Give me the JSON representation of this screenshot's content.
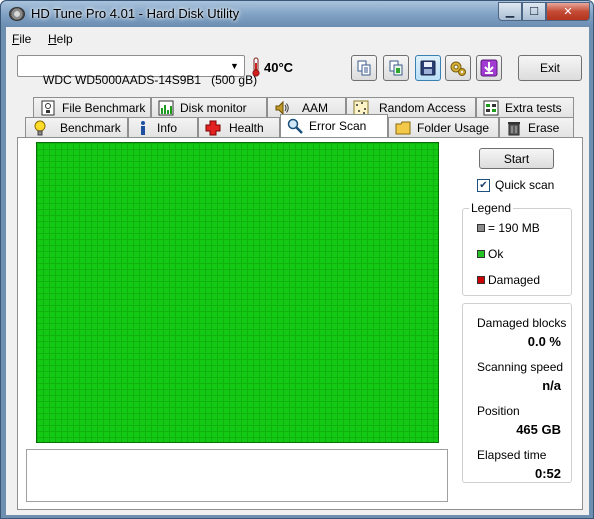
{
  "window": {
    "title": "HD Tune Pro 4.01 - Hard Disk Utility"
  },
  "menu": {
    "file": {
      "accel": "F",
      "rest": "ile"
    },
    "help": {
      "accel": "H",
      "rest": "elp"
    }
  },
  "toolbar": {
    "drive": "WDC WD5000AADS-14S9B1   (500 gB)",
    "temperature": "40°C",
    "buttons": [
      "copy-icon",
      "copy-screenshot-icon",
      "save-icon",
      "options-icon",
      "download-icon"
    ],
    "exit_label": "Exit"
  },
  "tabs": {
    "row1": [
      {
        "label": "File Benchmark",
        "icon": "file-benchmark-icon"
      },
      {
        "label": "Disk monitor",
        "icon": "disk-monitor-icon"
      },
      {
        "label": "AAM",
        "icon": "speaker-icon"
      },
      {
        "label": "Random Access",
        "icon": "random-access-icon"
      },
      {
        "label": "Extra tests",
        "icon": "extra-tests-icon"
      }
    ],
    "row2": [
      {
        "label": "Benchmark",
        "icon": "bulb-icon"
      },
      {
        "label": "Info",
        "icon": "info-icon"
      },
      {
        "label": "Health",
        "icon": "health-cross-icon"
      },
      {
        "label": "Error Scan",
        "icon": "magnifier-icon"
      },
      {
        "label": "Folder Usage",
        "icon": "folder-icon"
      },
      {
        "label": "Erase",
        "icon": "trash-icon"
      }
    ],
    "selected": "Error Scan"
  },
  "error_scan": {
    "start_label": "Start",
    "quick_scan_label": "Quick scan",
    "quick_scan_checked": true,
    "legend": {
      "title": "Legend",
      "block_size": "= 190 MB",
      "ok": "Ok",
      "damaged": "Damaged",
      "colors": {
        "block": "#8c8c8c",
        "ok": "#22c322",
        "damaged": "#cc0000"
      }
    },
    "stats": {
      "damaged_blocks_label": "Damaged blocks",
      "damaged_blocks_value": "0.0 %",
      "scanning_speed_label": "Scanning speed",
      "scanning_speed_value": "n/a",
      "position_label": "Position",
      "position_value": "465 GB",
      "elapsed_label": "Elapsed time",
      "elapsed_value": "0:52"
    },
    "grid_color": "#11cc11"
  }
}
